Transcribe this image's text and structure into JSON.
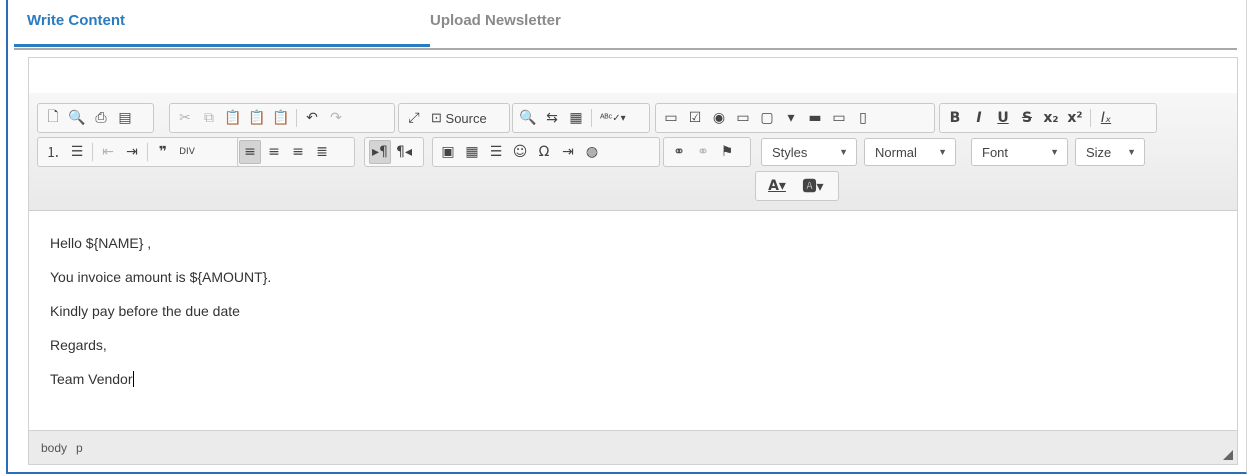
{
  "tabs": [
    {
      "label": "Write Content",
      "active": true
    },
    {
      "label": "Upload Newsletter",
      "active": false
    }
  ],
  "toolbar": {
    "row1_groups": [
      [
        "new-page-icon",
        "preview-icon",
        "print-icon",
        "templates-icon"
      ],
      [
        "cut-icon",
        "copy-icon",
        "paste-icon",
        "paste-text-icon",
        "paste-word-icon",
        "undo-icon",
        "redo-icon"
      ],
      [
        "maximize-icon",
        "source-icon"
      ],
      [
        "find-icon",
        "replace-icon",
        "select-all-icon",
        "spellcheck-icon"
      ],
      [
        "form-icon",
        "checkbox-icon",
        "radio-icon",
        "textfield-icon",
        "textarea-icon",
        "select-icon",
        "button-icon",
        "image-button-icon",
        "hidden-field-icon"
      ],
      [
        "bold-icon",
        "italic-icon",
        "underline-icon",
        "strike-icon",
        "subscript-icon",
        "superscript-icon",
        "remove-format-icon"
      ]
    ],
    "source_label": "Source",
    "styles_label": "Styles",
    "format_label": "Normal",
    "font_label": "Font",
    "size_label": "Size"
  },
  "content": {
    "lines": [
      "Hello ${NAME} ,",
      "You invoice amount is ${AMOUNT}.",
      "Kindly pay before the due date",
      "Regards,",
      "Team Vendor"
    ]
  },
  "statusbar": {
    "path": [
      "body",
      "p"
    ]
  }
}
